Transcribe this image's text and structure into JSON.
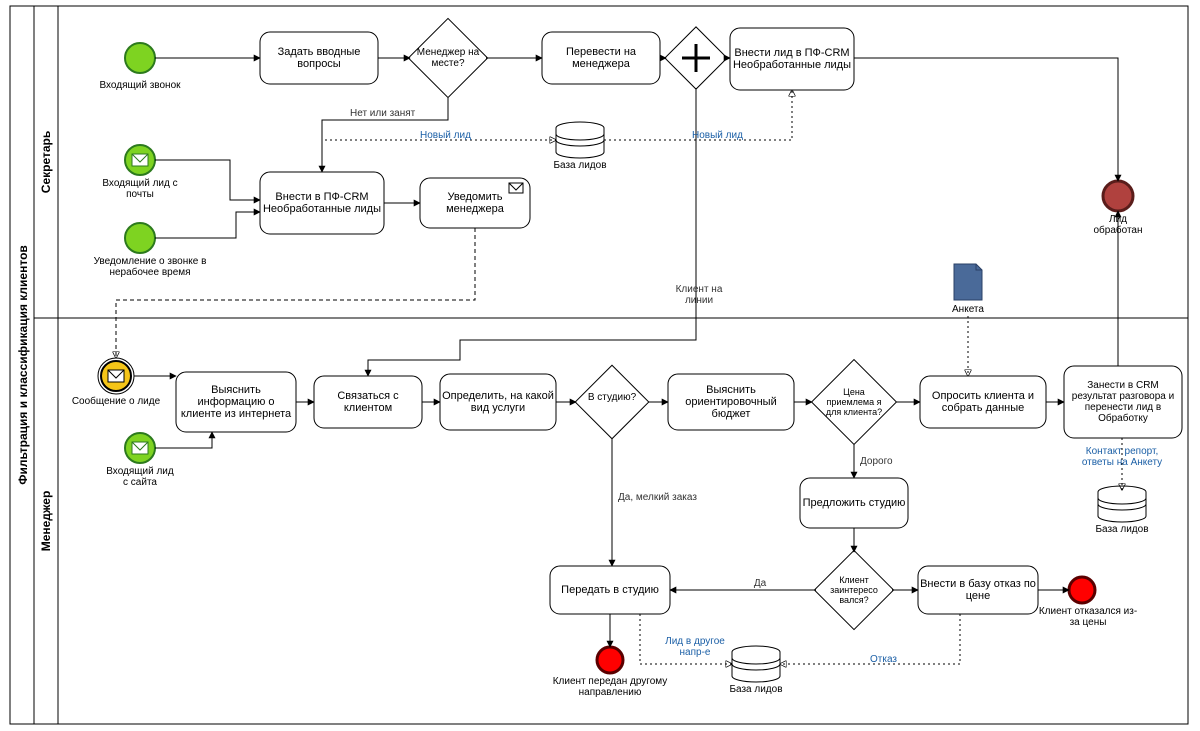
{
  "pool": {
    "label": "Фильтрация и классификация клиентов"
  },
  "lanes": {
    "secretary": {
      "label": "Секретарь"
    },
    "manager": {
      "label": "Менеджер"
    }
  },
  "events": {
    "call_in": {
      "label": "Входящий звонок"
    },
    "mail_in": {
      "label": "Входящий лид с почты"
    },
    "afterhours": {
      "label": "Уведомление о звонке в нерабочее время"
    },
    "lead_done": {
      "label": "Лид обработан"
    },
    "msg_about_lead": {
      "label": "Сообщение о лиде"
    },
    "lead_from_site": {
      "label": "Входящий лид с сайта"
    },
    "handed_off": {
      "label": "Клиент передан другому направлению"
    },
    "refused_price": {
      "label": "Клиент отказался из-за цены"
    }
  },
  "tasks": {
    "ask_intro": {
      "label": "Задать вводные вопросы"
    },
    "transfer_mgr": {
      "label": "Перевести на менеджера"
    },
    "put_lead_crm": {
      "label": "Внести лид в ПФ-CRM Необработанные лиды"
    },
    "put_pf_crm": {
      "label": "Внести в ПФ-CRM Необработанные лиды"
    },
    "notify_mgr": {
      "label": "Уведомить менеджера"
    },
    "dig_info": {
      "label": "Выяснить информацию о клиенте из интернета"
    },
    "contact": {
      "label": "Связаться с клиентом"
    },
    "det_service": {
      "label": "Определить, на какой вид услуги"
    },
    "est_budget": {
      "label": "Выяснить ориентировочный бюджет"
    },
    "offer_studio": {
      "label": "Предложить студию"
    },
    "survey": {
      "label": "Опросить клиента и собрать данные"
    },
    "save_crm": {
      "label": "Занести в CRM результат разговора и перенести лид в Обработку"
    },
    "hand_studio": {
      "label": "Передать в студию"
    },
    "refuse_db": {
      "label": "Внести в базу отказ по цене"
    }
  },
  "gateways": {
    "mgr_present": {
      "label": "Менеджер на месте?"
    },
    "parallel": {
      "label": ""
    },
    "to_studio": {
      "label": "В студию?"
    },
    "price_ok": {
      "label": "Цена приемлема я для клиента?"
    },
    "interested": {
      "label": "Клиент заинтересо вался?"
    }
  },
  "artifacts": {
    "questionnaire": {
      "label": "Анкета"
    },
    "contact_report": {
      "label": "Контакт репорт, ответы на Анкету"
    }
  },
  "datastores": {
    "leads1": {
      "label": "База лидов"
    },
    "leads2": {
      "label": "База лидов"
    },
    "leads3": {
      "label": "База лидов"
    }
  },
  "edge_labels": {
    "no_or_busy": "Нет или занят",
    "new_lead": "Новый лид",
    "client_line": "Клиент на линии",
    "yes_small": "Да, мелкий заказ",
    "expensive": "Дорого",
    "yes": "Да",
    "refuse": "Отказ",
    "other_dir": "Лид в другое напр-е"
  }
}
